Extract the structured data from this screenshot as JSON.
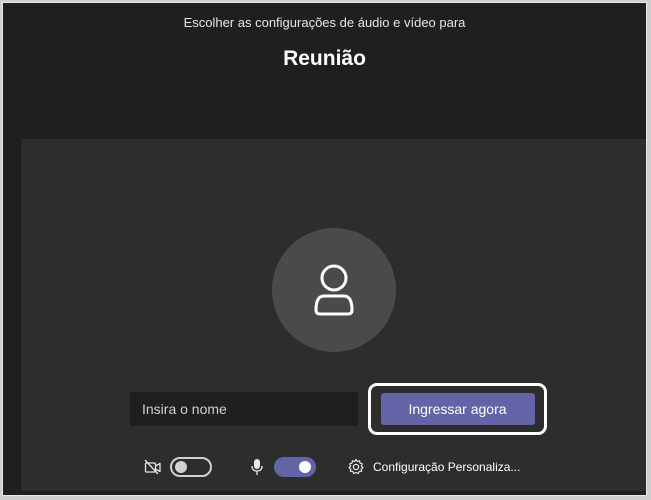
{
  "header": {
    "subtitle": "Escolher as configurações de áudio e vídeo para",
    "title": "Reunião"
  },
  "preview": {
    "avatar_icon": "person-icon",
    "name_input": {
      "value": "",
      "placeholder": "Insira o nome"
    },
    "join_button_label": "Ingressar agora"
  },
  "controls": {
    "camera": {
      "icon": "camera-off-icon",
      "enabled": false
    },
    "microphone": {
      "icon": "microphone-icon",
      "enabled": true
    },
    "settings": {
      "icon": "gear-icon",
      "label": "Configuração Personaliza..."
    }
  },
  "colors": {
    "accent": "#6264a7",
    "background": "#1f1f1f",
    "preview_background": "#2d2d2d"
  }
}
